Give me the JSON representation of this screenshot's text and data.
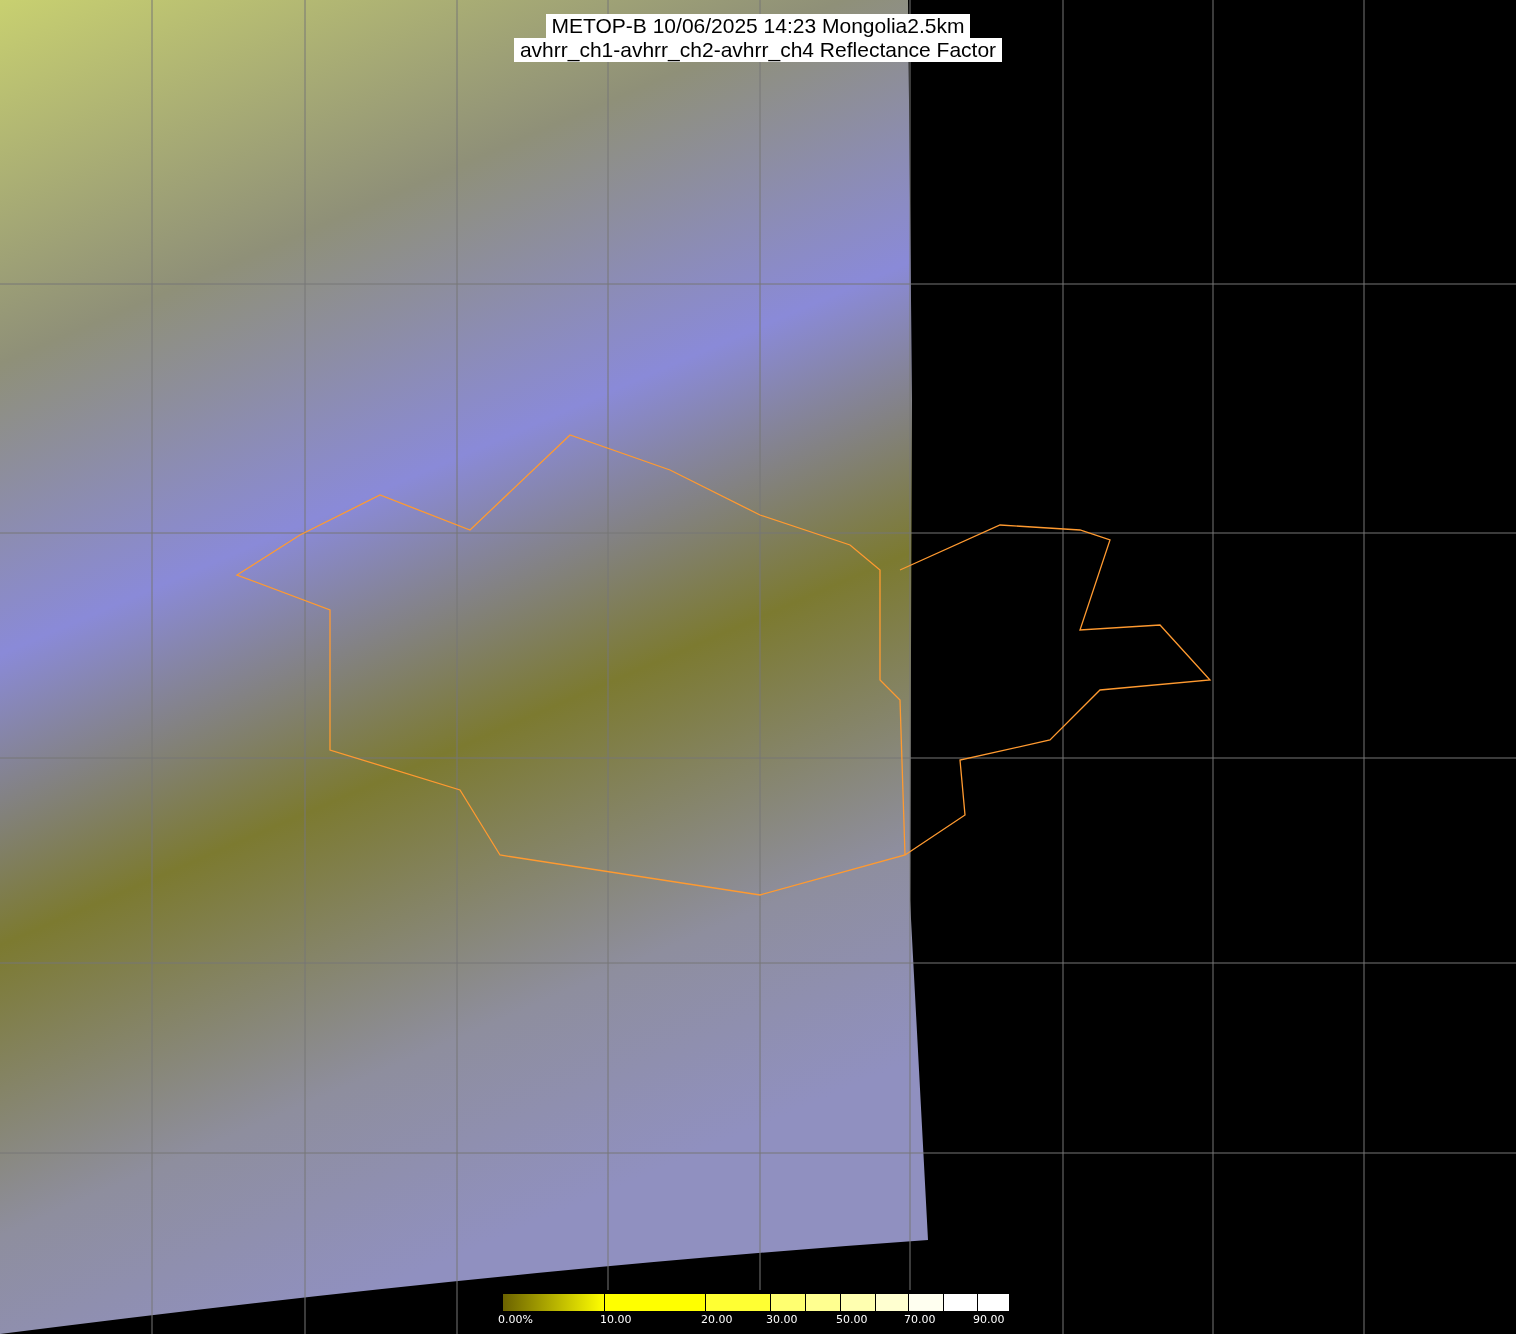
{
  "title": {
    "line_1": "METOP-B 10/06/2025 14:23 Mongolia2.5km",
    "line_2": "avhrr_ch1-avhrr_ch2-avhrr_ch4 Reflectance Factor"
  },
  "colorbar": {
    "labels": [
      "0.00%",
      "10.00",
      "20.00",
      "30.00",
      "50.00",
      "70.00",
      "90.00"
    ]
  }
}
